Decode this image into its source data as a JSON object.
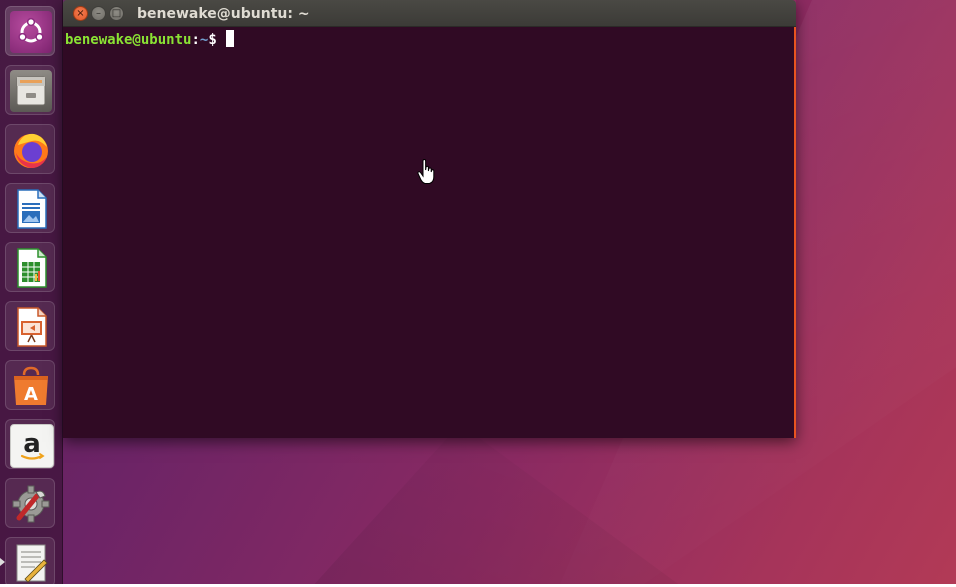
{
  "terminal": {
    "title": "benewake@ubuntu: ~",
    "prompt": {
      "user": "benewake@ubuntu",
      "colon": ":",
      "path": "~",
      "symbol": "$ "
    },
    "close_glyph": "×",
    "min_glyph": "–",
    "max_glyph": "□"
  },
  "launcher": {
    "items": [
      {
        "icon": "ubuntu-dash-icon"
      },
      {
        "icon": "files-icon"
      },
      {
        "icon": "firefox-icon"
      },
      {
        "icon": "libreoffice-writer-icon"
      },
      {
        "icon": "libreoffice-calc-icon"
      },
      {
        "icon": "libreoffice-impress-icon"
      },
      {
        "icon": "ubuntu-software-icon",
        "glyph": "A"
      },
      {
        "icon": "amazon-icon",
        "glyph": "a"
      },
      {
        "icon": "system-settings-icon"
      },
      {
        "icon": "text-editor-icon"
      }
    ]
  },
  "colors": {
    "terminal_background": "#300a24",
    "prompt_user": "#8ae234",
    "prompt_path": "#729fcf",
    "accent_orange": "#e95420"
  }
}
